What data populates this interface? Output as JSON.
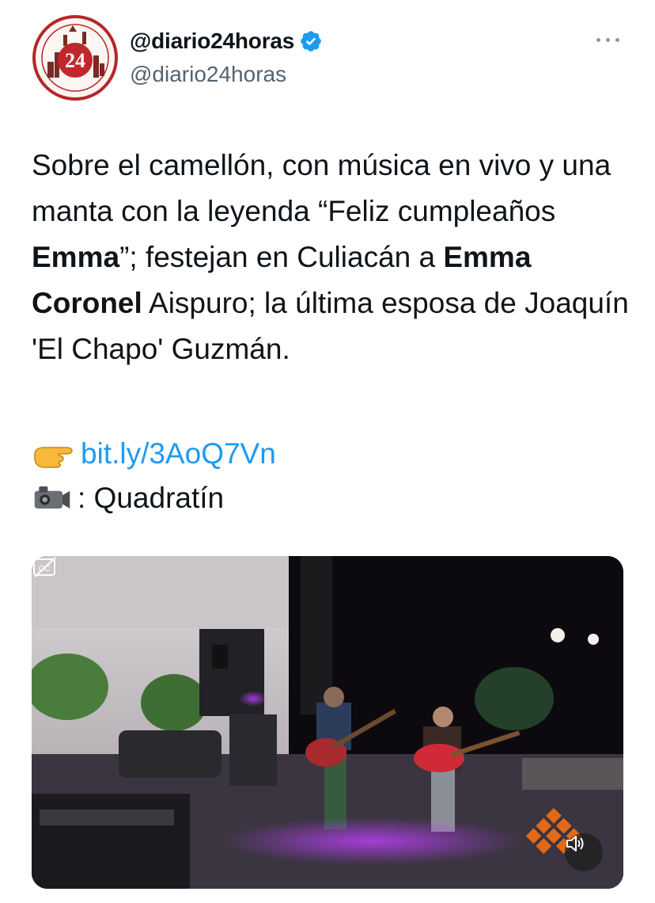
{
  "account": {
    "display_name": "@diario24horas",
    "handle": "@diario24horas",
    "avatar_label": "24",
    "verified": true
  },
  "tweet": {
    "segments": [
      {
        "text": "Sobre el camellón, con música en vivo y una manta con la leyenda “Feliz cumpleaños ",
        "bold": false
      },
      {
        "text": "Emma",
        "bold": true
      },
      {
        "text": "”; festejan en Culiacán a ",
        "bold": false
      },
      {
        "text": "Emma Coronel",
        "bold": true
      },
      {
        "text": " Aispuro; la última esposa de Joaquín 'El Chapo' Guzmán.",
        "bold": false
      }
    ],
    "link_emoji": "pointing-hand-icon",
    "link_text": "bit.ly/3AoQ7Vn",
    "credit_emoji": "video-camera-icon",
    "credit_text": ": Quadratín"
  },
  "media": {
    "type": "video",
    "cc_icon": "closed-captions-off-icon",
    "volume_icon": "volume-muted-icon"
  },
  "colors": {
    "link": "#1d9bf0",
    "verified": "#1d9bf0",
    "text": "#0f1419",
    "secondary": "#536471"
  }
}
